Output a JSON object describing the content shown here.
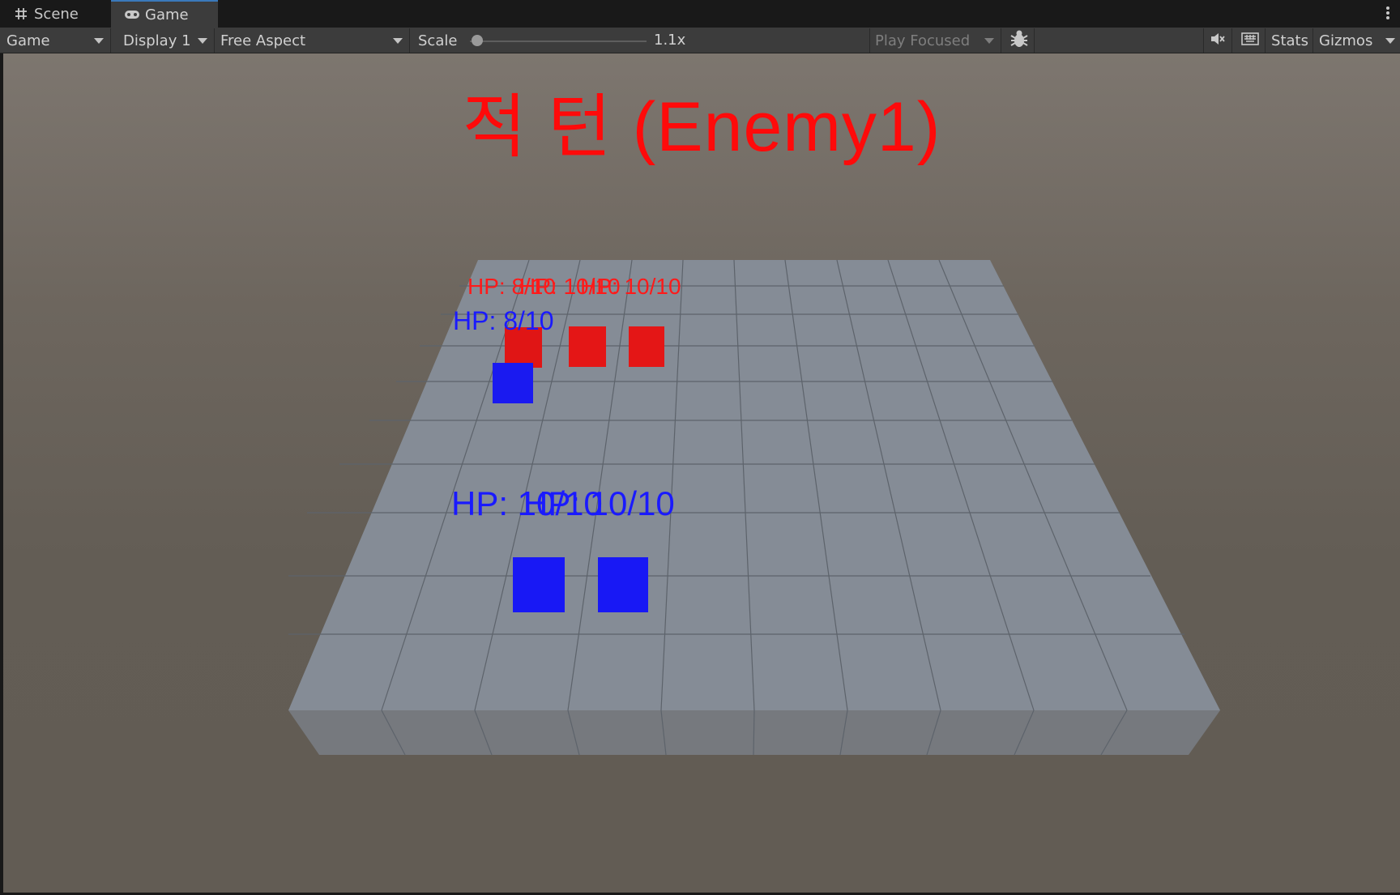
{
  "tabs": {
    "scene": {
      "label": "Scene",
      "icon": "grid-hash-icon"
    },
    "game": {
      "label": "Game",
      "icon": "gamepad-icon"
    }
  },
  "toolbar": {
    "view_mode": "Game",
    "display": "Display 1",
    "aspect": "Free Aspect",
    "scale_label": "Scale",
    "scale_value": "1.1x",
    "play_mode": "Play Focused",
    "stats_label": "Stats",
    "gizmos_label": "Gizmos"
  },
  "game": {
    "turn_title": "적 턴 (Enemy1)",
    "colors": {
      "enemy": "#ff1a1a",
      "player": "#1a1aff",
      "title": "#ff0a0a"
    },
    "enemy_hp_labels": [
      "HP: 8/10",
      "HP: 10/10",
      "HP: 10/10"
    ],
    "player_hp_labels": [
      "HP: 8/10",
      "HP: 10/10",
      "HP: 10/10"
    ]
  }
}
